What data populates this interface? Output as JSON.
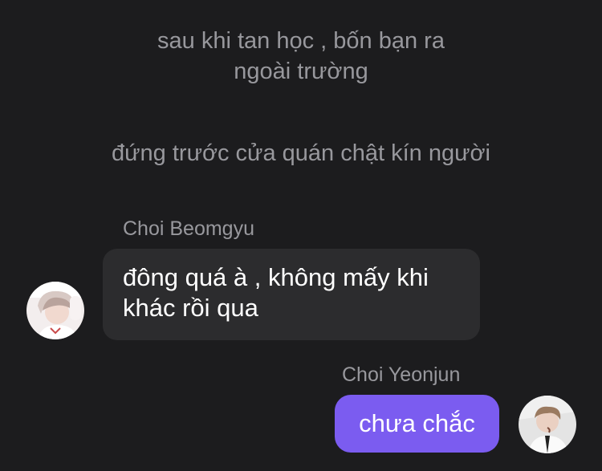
{
  "narration": {
    "first": [
      "sau khi tan học , bốn bạn ra",
      "ngoài trường"
    ],
    "second": "đứng trước cửa quán chật kín người"
  },
  "messages": [
    {
      "sender": "Choi Beomgyu",
      "direction": "incoming",
      "lines": [
        "đông quá à , không mấy khi",
        "khác rồi qua"
      ]
    },
    {
      "sender": "Choi Yeonjun",
      "direction": "outgoing",
      "text": "chưa chắc"
    }
  ],
  "colors": {
    "background": "#1c1c1e",
    "incoming_bubble": "#2c2c2e",
    "outgoing_bubble": "#7b5cf0",
    "secondary_text": "#98989d"
  }
}
